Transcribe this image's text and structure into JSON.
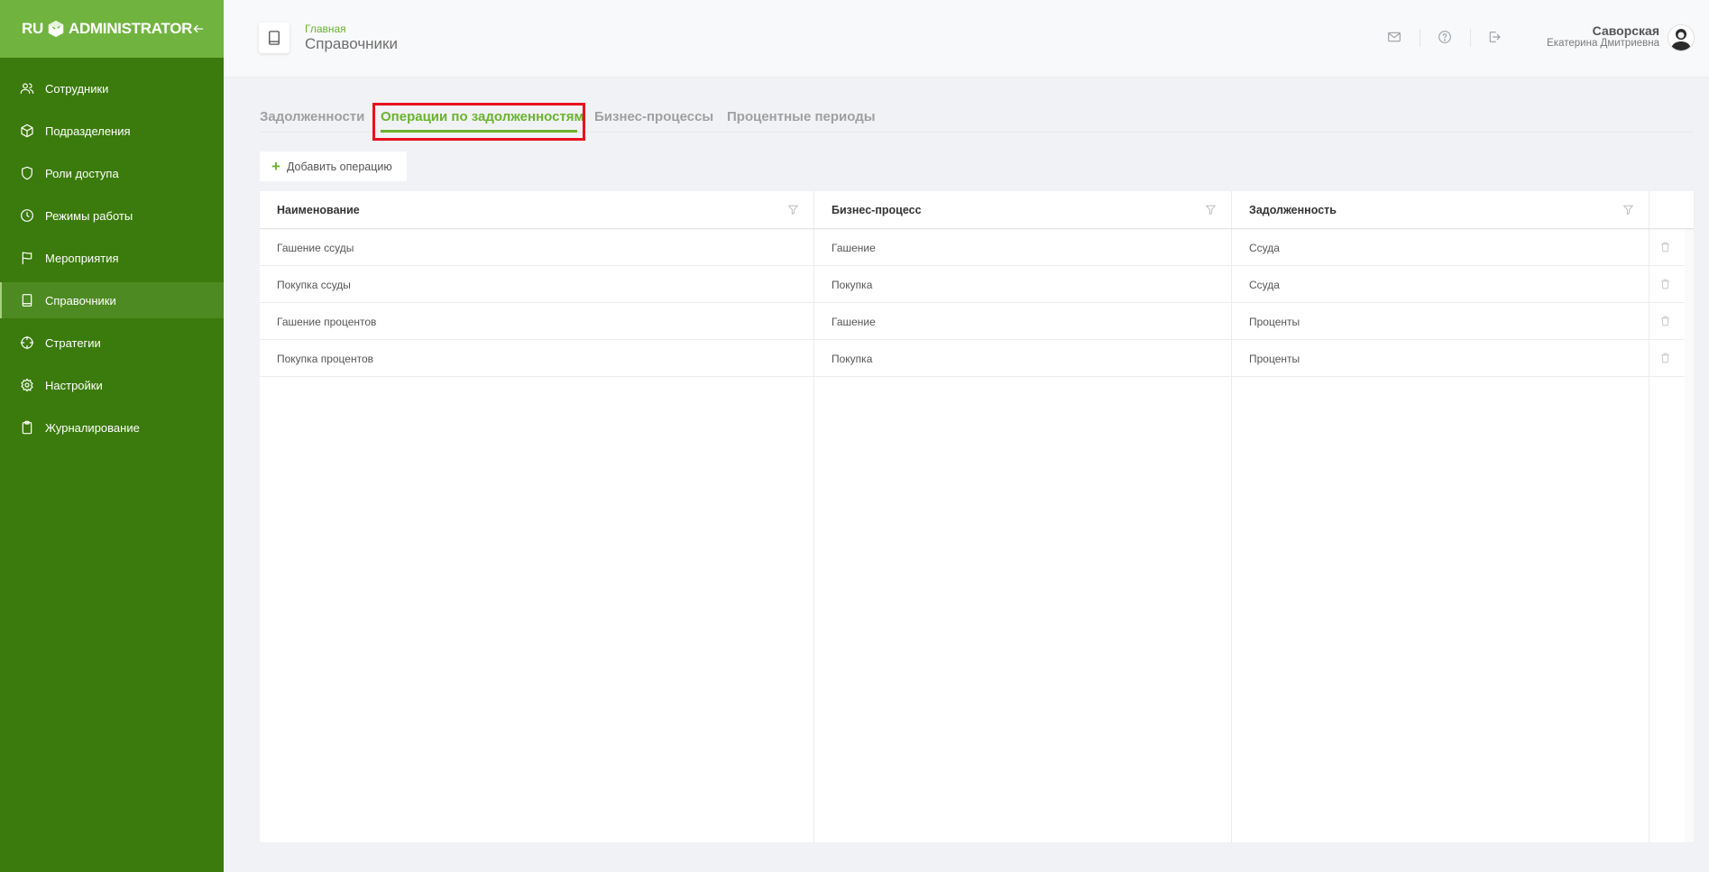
{
  "app": {
    "logo_left": "RU",
    "logo_right": "ADMINISTRATOR"
  },
  "sidebar": {
    "items": [
      {
        "label": "Сотрудники",
        "icon": "users-icon"
      },
      {
        "label": "Подразделения",
        "icon": "box-icon"
      },
      {
        "label": "Роли доступа",
        "icon": "shield-icon"
      },
      {
        "label": "Режимы работы",
        "icon": "clock-icon"
      },
      {
        "label": "Мероприятия",
        "icon": "flag-icon"
      },
      {
        "label": "Справочники",
        "icon": "book-icon",
        "active": true
      },
      {
        "label": "Стратегии",
        "icon": "crosshair-icon"
      },
      {
        "label": "Настройки",
        "icon": "gear-icon"
      },
      {
        "label": "Журналирование",
        "icon": "clipboard-icon"
      }
    ]
  },
  "header": {
    "breadcrumb": "Главная",
    "title": "Справочники",
    "user": {
      "last_name": "Саворская",
      "first_names": "Екатерина Дмитриевна"
    }
  },
  "tabs": [
    {
      "label": "Задолженности"
    },
    {
      "label": "Операции по задолженностям",
      "active": true
    },
    {
      "label": "Бизнес-процессы"
    },
    {
      "label": "Процентные периоды"
    }
  ],
  "toolbar": {
    "add_label": "Добавить операцию"
  },
  "table": {
    "columns": [
      "Наименование",
      "Бизнес-процесс",
      "Задолженность"
    ],
    "rows": [
      [
        "Гашение ссуды",
        "Гашение",
        "Ссуда"
      ],
      [
        "Покупка ссуды",
        "Покупка",
        "Ссуда"
      ],
      [
        "Гашение процентов",
        "Гашение",
        "Проценты"
      ],
      [
        "Покупка процентов",
        "Покупка",
        "Проценты"
      ]
    ]
  },
  "colors": {
    "sidebar_bg": "#3b7a0c",
    "sidebar_header": "#71b33f",
    "accent": "#6bb32e",
    "highlight": "#e8111e"
  }
}
